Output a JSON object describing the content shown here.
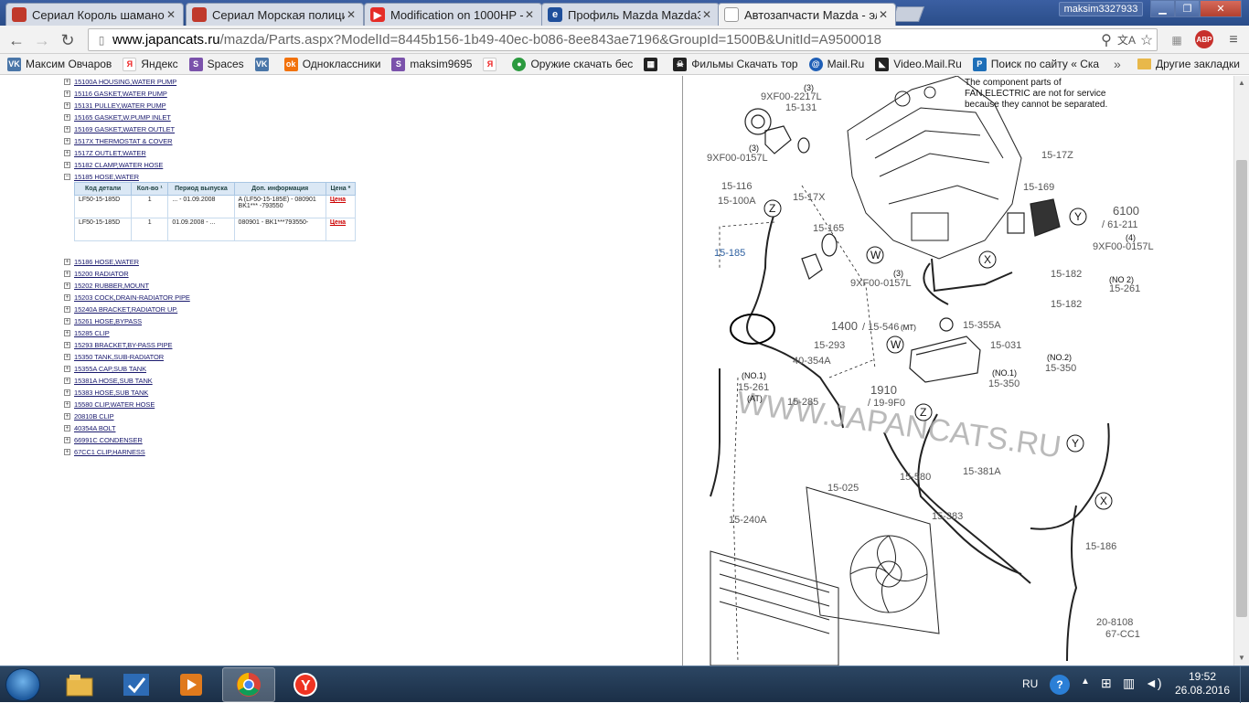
{
  "browser": {
    "tabs": [
      {
        "title": "Сериал Король шаманов",
        "favicon_color": "#c0392b",
        "favicon_text": ""
      },
      {
        "title": "Сериал Морская полици",
        "favicon_color": "#c0392b",
        "favicon_text": ""
      },
      {
        "title": "Modification on 1000HP -",
        "favicon_color": "#e52d27",
        "favicon_text": "▶"
      },
      {
        "title": "Профиль Mazda Mazda3",
        "favicon_color": "#1f4f9b",
        "favicon_text": "e"
      },
      {
        "title": "Автозапчасти Mazda - эл",
        "favicon_color": "#ffffff",
        "favicon_text": ""
      }
    ],
    "user": "maksim3327933",
    "url_host": "www.japancats.ru",
    "url_rest": "/mazda/Parts.aspx?ModelId=8445b156-1b49-40ec-b086-8ee843ae7196&GroupId=1500B&UnitId=A9500018",
    "abp_label": "ABP"
  },
  "bookmarks": [
    {
      "label": "Максим Овчаров",
      "icon_text": "VK",
      "icon_color": "#4a76a8"
    },
    {
      "label": "Яндекс",
      "icon_text": "Я",
      "icon_color": "#ffffff"
    },
    {
      "label": "Spaces",
      "icon_text": "S",
      "icon_color": "#7b52ab"
    },
    {
      "label": "",
      "icon_text": "VK",
      "icon_color": "#4a76a8"
    },
    {
      "label": "Одноклассники",
      "icon_text": "ok",
      "icon_color": "#f2720c"
    },
    {
      "label": "maksim9695",
      "icon_text": "S",
      "icon_color": "#7b52ab"
    },
    {
      "label": "",
      "icon_text": "Я",
      "icon_color": "#ffffff"
    },
    {
      "label": "Оружие скачать бес",
      "icon_text": "●",
      "icon_color": "#2b9a3f"
    },
    {
      "label": "",
      "icon_text": "▦",
      "icon_color": "#222222"
    },
    {
      "label": "Фильмы Скачать тор",
      "icon_text": "☠",
      "icon_color": "#222222"
    },
    {
      "label": "Mail.Ru",
      "icon_text": "@",
      "icon_color": "#1f5fb6"
    },
    {
      "label": "Video.Mail.Ru",
      "icon_text": "◣",
      "icon_color": "#222222"
    },
    {
      "label": "Поиск по сайту « Ска",
      "icon_text": "P",
      "icon_color": "#1e6fb8"
    }
  ],
  "bookmarks_more": "»",
  "bookmarks_other": "Другие закладки",
  "tree": {
    "items_before": [
      "15100A HOUSING,WATER PUMP",
      "15116 GASKET,WATER PUMP",
      "15131 PULLEY,WATER PUMP",
      "15165 GASKET,W.PUMP INLET",
      "15169 GASKET,WATER OUTLET",
      "1517X THERMOSTAT & COVER",
      "1517Z OUTLET,WATER",
      "15182 CLAMP,WATER HOSE",
      "15185 HOSE,WATER"
    ],
    "items_after": [
      "15186 HOSE,WATER",
      "15200 RADIATOR",
      "15202 RUBBER,MOUNT",
      "15203 COCK,DRAIN-RADIATOR PIPE",
      "15240A BRACKET,RADIATOR UP.",
      "15261 HOSE,BYPASS",
      "15285 CLIP",
      "15293 BRACKET,BY-PASS PIPE",
      "15350 TANK,SUB-RADIATOR",
      "15355A CAP,SUB TANK",
      "15381A HOSE,SUB TANK",
      "15383 HOSE,SUB TANK",
      "15580 CLIP,WATER HOSE",
      "20810B CLIP",
      "40354A BOLT",
      "66991C CONDENSER",
      "67CC1 CLIP,HARNESS"
    ]
  },
  "parts_table": {
    "headers": [
      "Код детали",
      "Кол-во ¹",
      "Период выпуска",
      "Доп. информация",
      "Цена *"
    ],
    "rows": [
      {
        "code": "LF50-15-185D",
        "qty": "1",
        "period": "... - 01.09.2008",
        "info": "A (LF50-15-185E) - 080901 BK1*** -793550",
        "price": "Цена"
      },
      {
        "code": "LF50-15-185D",
        "qty": "1",
        "period": "01.09.2008 - ...",
        "info": "080901 - BK1***793550-",
        "price": "Цена"
      }
    ]
  },
  "diagram": {
    "note": [
      "The component parts of",
      "FAN,ELECTRIC are not for service",
      "because they cannot be separated."
    ],
    "watermark": "WWW.JAPANCATS.RU",
    "labels": {
      "l1": "9XF00-2217L",
      "l2": "(3)",
      "l3": "15-131",
      "l4": "(3)",
      "l5": "9XF00-0157L",
      "l6": "15-116",
      "l7": "15-100A",
      "l8": "15-17X",
      "l9": "15-165",
      "l10": "15-17Z",
      "l11": "15-169",
      "l12": "6100",
      "l13": "/ 61-211",
      "l14": "(4)",
      "l15": "9XF00-0157L",
      "l16": "15-185",
      "l17": "15-182",
      "l18": "(NO 2)",
      "l19": "15-261",
      "l20": "15-182",
      "l21": "(3)",
      "l22": "9XF00-0157L",
      "l23": "1400",
      "l24": "/ 15-546",
      "l25": "(MT)",
      "l26": "15-355A",
      "l27": "15-031",
      "l28": "(NO.2)",
      "l29": "15-350",
      "l30": "(NO.1)",
      "l31": "15-350",
      "l32": "15-293",
      "l33": "40-354A",
      "l34": "(NO.1)",
      "l35": "15-261",
      "l36": "(AT)",
      "l37": "15-285",
      "l38": "1910",
      "l39": "/ 19-9F0",
      "l40": "15-580",
      "l41": "15-381A",
      "l42": "15-383",
      "l43": "15-025",
      "l44": "15-240A",
      "l45": "15-186",
      "l46": "20-8108",
      "l47": "67-CC1",
      "l48": "15-186",
      "cZ1": "Z",
      "cY1": "Y",
      "cW1": "W",
      "cX1": "X",
      "cW2": "W",
      "cZ2": "Z",
      "cY2": "Y",
      "cX2": "X"
    }
  },
  "taskbar": {
    "lang": "RU",
    "time": "19:52",
    "date": "26.08.2016"
  }
}
